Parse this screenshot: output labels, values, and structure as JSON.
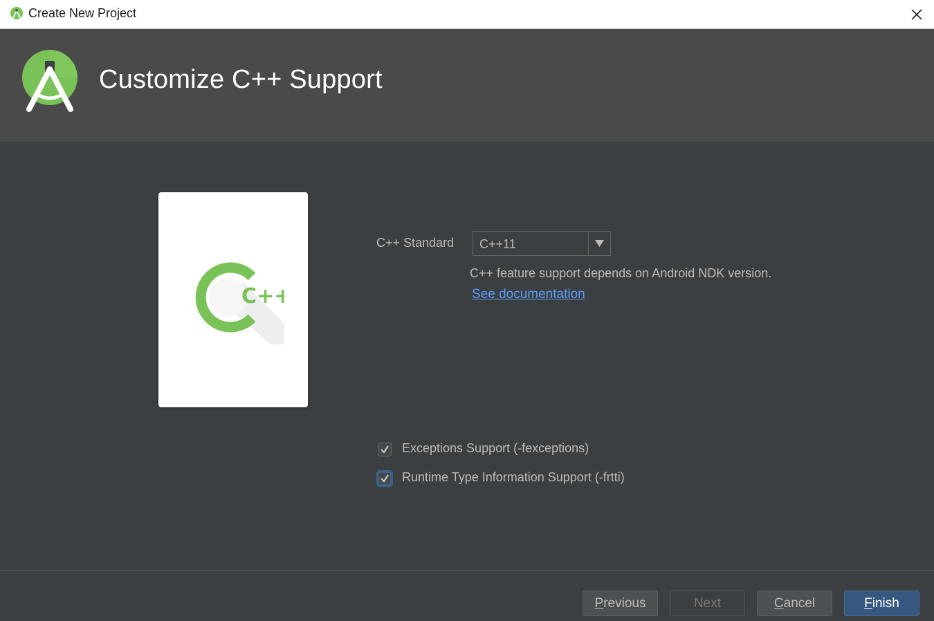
{
  "window": {
    "title": "Create New Project",
    "close_icon": "close-icon",
    "app_icon": "android-studio-icon"
  },
  "header": {
    "title": "Customize C++ Support",
    "logo_icon": "android-studio-logo-icon"
  },
  "card": {
    "icon": "cpp-icon",
    "icon_text": "C++"
  },
  "cpp_standard": {
    "label": "C++ Standard",
    "selected": "C++11",
    "note": "C++ feature support depends on Android NDK version.",
    "link": "See documentation"
  },
  "options": [
    {
      "label": "Exceptions Support (-fexceptions)",
      "checked": true
    },
    {
      "label": "Runtime Type Information Support (-frtti)",
      "checked": true,
      "focused": true
    }
  ],
  "buttons": {
    "previous": {
      "mnemonic": "P",
      "rest": "revious"
    },
    "next": {
      "label": "Next",
      "disabled": true
    },
    "cancel": {
      "mnemonic": "C",
      "rest": "ancel"
    },
    "finish": {
      "mnemonic": "F",
      "rest": "inish"
    }
  },
  "colors": {
    "background": "#3c3f41",
    "header_background": "#4a4a4a",
    "android_green": "#78c257",
    "link": "#589df6",
    "primary_button": "#365880"
  }
}
